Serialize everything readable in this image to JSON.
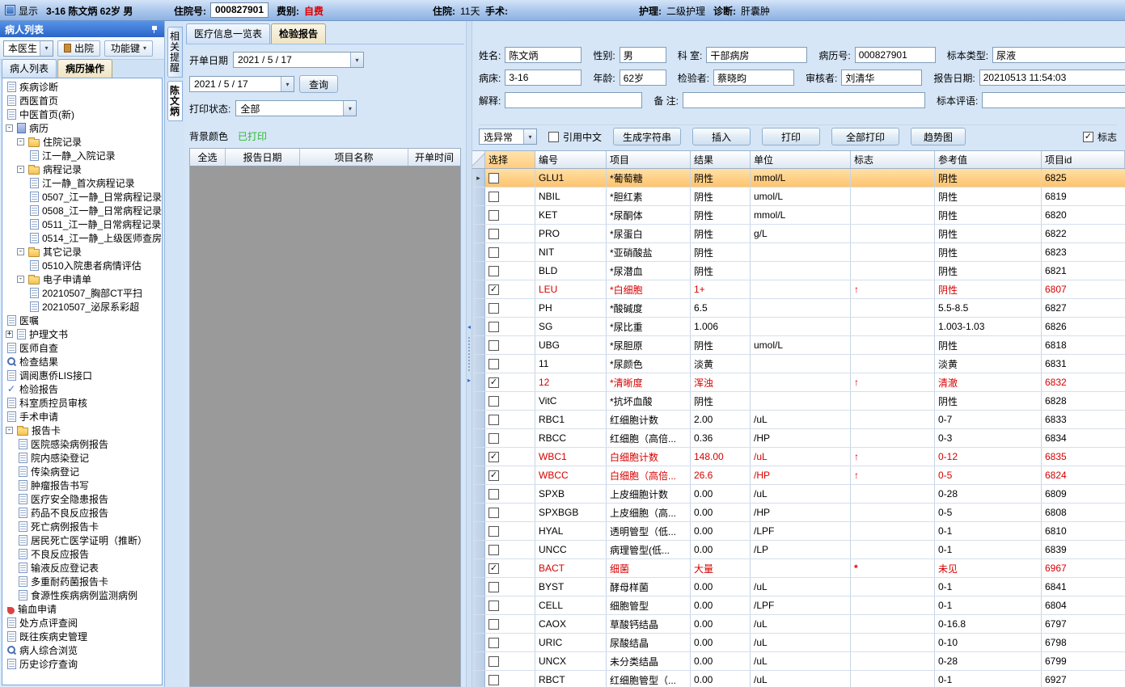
{
  "top_bar": {
    "display": "显示",
    "patient_summary": "3-16   陈文炳 62岁 男",
    "admission_label": "住院号:",
    "admission_no": "000827901",
    "fee_label": "费别:",
    "fee": "自费",
    "stay_label": "住院:",
    "stay": "11天",
    "surgery_label": "手术:",
    "nursing_label": "护理:",
    "nursing": "二级护理",
    "diagnosis_label": "诊断:",
    "diagnosis": "肝囊肿"
  },
  "sidebar": {
    "title": "病人列表",
    "doctor_filter": "本医生",
    "discharge": "出院",
    "function_keys": "功能键",
    "tabs": [
      {
        "label": "病人列表"
      },
      {
        "label": "病历操作"
      }
    ],
    "tree": [
      {
        "level": 0,
        "icon": "doc",
        "label": "疾病诊断"
      },
      {
        "level": 0,
        "icon": "doc",
        "label": "西医首页"
      },
      {
        "level": 0,
        "icon": "doc",
        "label": "中医首页(新)"
      },
      {
        "level": 0,
        "icon": "book",
        "exp": "-",
        "label": "病历"
      },
      {
        "level": 1,
        "icon": "folder",
        "exp": "-",
        "label": "住院记录"
      },
      {
        "level": 2,
        "icon": "doc",
        "label": "江一静_入院记录"
      },
      {
        "level": 1,
        "icon": "folder",
        "exp": "-",
        "label": "病程记录"
      },
      {
        "level": 2,
        "icon": "doc",
        "label": "江一静_首次病程记录"
      },
      {
        "level": 2,
        "icon": "doc",
        "label": "0507_江一静_日常病程记录"
      },
      {
        "level": 2,
        "icon": "doc",
        "label": "0508_江一静_日常病程记录"
      },
      {
        "level": 2,
        "icon": "doc",
        "label": "0511_江一静_日常病程记录"
      },
      {
        "level": 2,
        "icon": "doc",
        "label": "0514_江一静_上级医师查房"
      },
      {
        "level": 1,
        "icon": "folder",
        "exp": "-",
        "label": "其它记录"
      },
      {
        "level": 2,
        "icon": "doc",
        "label": "0510入院患者病情评估"
      },
      {
        "level": 1,
        "icon": "folder",
        "exp": "-",
        "label": "电子申请单"
      },
      {
        "level": 2,
        "icon": "doc",
        "label": "20210507_胸部CT平扫"
      },
      {
        "level": 2,
        "icon": "doc",
        "label": "20210507_泌尿系彩超"
      },
      {
        "level": 0,
        "icon": "doc",
        "label": "医嘱"
      },
      {
        "level": 0,
        "icon": "doc",
        "exp": "+",
        "label": "护理文书"
      },
      {
        "level": 0,
        "icon": "doc",
        "label": "医师自查"
      },
      {
        "level": 0,
        "icon": "search",
        "label": "检查结果"
      },
      {
        "level": 0,
        "icon": "doc",
        "label": "调阅惠侨LIS接口"
      },
      {
        "level": 0,
        "icon": "check",
        "label": "检验报告"
      },
      {
        "level": 0,
        "icon": "doc",
        "label": "科室质控员审核"
      },
      {
        "level": 0,
        "icon": "doc",
        "label": "手术申请"
      },
      {
        "level": 0,
        "icon": "folder",
        "exp": "-",
        "label": "报告卡"
      },
      {
        "level": 1,
        "icon": "doc",
        "label": "医院感染病例报告"
      },
      {
        "level": 1,
        "icon": "doc",
        "label": "院内感染登记"
      },
      {
        "level": 1,
        "icon": "doc",
        "label": "传染病登记"
      },
      {
        "level": 1,
        "icon": "doc",
        "label": "肿瘤报告书写"
      },
      {
        "level": 1,
        "icon": "doc",
        "label": "医疗安全隐患报告"
      },
      {
        "level": 1,
        "icon": "doc",
        "label": "药品不良反应报告"
      },
      {
        "level": 1,
        "icon": "doc",
        "label": "死亡病例报告卡"
      },
      {
        "level": 1,
        "icon": "doc",
        "label": "居民死亡医学证明（推断）"
      },
      {
        "level": 1,
        "icon": "doc",
        "label": "不良反应报告"
      },
      {
        "level": 1,
        "icon": "doc",
        "label": "输液反应登记表"
      },
      {
        "level": 1,
        "icon": "doc",
        "label": "多重耐药菌报告卡"
      },
      {
        "level": 1,
        "icon": "doc",
        "label": "食源性疾病病例监测病例"
      },
      {
        "level": 0,
        "icon": "blood",
        "label": "输血申请"
      },
      {
        "level": 0,
        "icon": "doc",
        "label": "处方点评查阅"
      },
      {
        "level": 0,
        "icon": "doc",
        "label": "既往疾病史管理"
      },
      {
        "level": 0,
        "icon": "search",
        "label": "病人综合浏览"
      },
      {
        "level": 0,
        "icon": "doc",
        "label": "历史诊疗查询"
      }
    ]
  },
  "side_strip": {
    "reminder_tab": "相关提醒",
    "patient_tab": "陈文炳"
  },
  "middle": {
    "tabs": [
      {
        "label": "医疗信息一览表"
      },
      {
        "label": "检验报告"
      }
    ],
    "order_date_label": "开单日期",
    "date_from": "2021 / 5 / 17",
    "date_to": "2021 / 5 / 17",
    "query": "查询",
    "print_status_label": "打印状态:",
    "print_status": "全部",
    "bg_label": "背景颜色",
    "printed": "已打印",
    "headers": [
      "全选",
      "报告日期",
      "项目名称",
      "开单时间"
    ]
  },
  "report": {
    "info": {
      "name_label": "姓名:",
      "name": "陈文炳",
      "sex_label": "性别:",
      "sex": "男",
      "dept_label": "科  室:",
      "dept": "干部病房",
      "chart_label": "病历号:",
      "chart_no": "000827901",
      "specimen_label": "标本类型:",
      "specimen": "尿液",
      "bed_label": "病床:",
      "bed": "3-16",
      "age_label": "年龄:",
      "age": "62岁",
      "tester_label": "检验者:",
      "tester": "蔡晓昀",
      "reviewer_label": "审核者:",
      "reviewer": "刘清华",
      "date_label": "报告日期:",
      "date": "20210513 11:54:03",
      "explain_label": "解释:",
      "note_label": "备  注:",
      "comment_label": "标本评语:"
    },
    "toolbar": {
      "select_abnormal": "选异常",
      "quote_chinese": "引用中文",
      "generate_string": "生成字符串",
      "insert": "插入",
      "print": "打印",
      "print_all": "全部打印",
      "trend_chart": "趋势图",
      "flag": "标志"
    },
    "table": {
      "headers": [
        "选择",
        "编号",
        "项目",
        "结果",
        "单位",
        "标志",
        "参考值",
        "项目id"
      ],
      "rows": [
        {
          "c": false,
          "code": "GLU1",
          "item": "*葡萄糖",
          "res": "阴性",
          "unit": "mmol/L",
          "flag": "",
          "ref": "阴性",
          "id": "6825",
          "ab": false,
          "sel": true
        },
        {
          "c": false,
          "code": "NBIL",
          "item": "*胆红素",
          "res": "阴性",
          "unit": "umol/L",
          "flag": "",
          "ref": "阴性",
          "id": "6819",
          "ab": false,
          "sel": false
        },
        {
          "c": false,
          "code": "KET",
          "item": "*尿酮体",
          "res": "阴性",
          "unit": "mmol/L",
          "flag": "",
          "ref": "阴性",
          "id": "6820",
          "ab": false,
          "sel": false
        },
        {
          "c": false,
          "code": "PRO",
          "item": "*尿蛋白",
          "res": "阴性",
          "unit": "g/L",
          "flag": "",
          "ref": "阴性",
          "id": "6822",
          "ab": false,
          "sel": false
        },
        {
          "c": false,
          "code": "NIT",
          "item": "*亚硝酸盐",
          "res": "阴性",
          "unit": "",
          "flag": "",
          "ref": "阴性",
          "id": "6823",
          "ab": false,
          "sel": false
        },
        {
          "c": false,
          "code": "BLD",
          "item": "*尿潜血",
          "res": "阴性",
          "unit": "",
          "flag": "",
          "ref": "阴性",
          "id": "6821",
          "ab": false,
          "sel": false
        },
        {
          "c": true,
          "code": "LEU",
          "item": "*白细胞",
          "res": "1+",
          "unit": "",
          "flag": "↑",
          "ref": "阴性",
          "id": "6807",
          "ab": true,
          "sel": false
        },
        {
          "c": false,
          "code": "PH",
          "item": "*酸碱度",
          "res": "6.5",
          "unit": "",
          "flag": "",
          "ref": "5.5-8.5",
          "id": "6827",
          "ab": false,
          "sel": false
        },
        {
          "c": false,
          "code": "SG",
          "item": "*尿比重",
          "res": "1.006",
          "unit": "",
          "flag": "",
          "ref": "1.003-1.03",
          "id": "6826",
          "ab": false,
          "sel": false
        },
        {
          "c": false,
          "code": "UBG",
          "item": "*尿胆原",
          "res": "阴性",
          "unit": "umol/L",
          "flag": "",
          "ref": "阴性",
          "id": "6818",
          "ab": false,
          "sel": false
        },
        {
          "c": false,
          "code": "11",
          "item": "*尿颜色",
          "res": "淡黄",
          "unit": "",
          "flag": "",
          "ref": "淡黄",
          "id": "6831",
          "ab": false,
          "sel": false
        },
        {
          "c": true,
          "code": "12",
          "item": "*清晰度",
          "res": "浑浊",
          "unit": "",
          "flag": "↑",
          "ref": "清澈",
          "id": "6832",
          "ab": true,
          "sel": false
        },
        {
          "c": false,
          "code": "VitC",
          "item": "*抗坏血酸",
          "res": "阴性",
          "unit": "",
          "flag": "",
          "ref": "阴性",
          "id": "6828",
          "ab": false,
          "sel": false
        },
        {
          "c": false,
          "code": "RBC1",
          "item": "红细胞计数",
          "res": "2.00",
          "unit": "/uL",
          "flag": "",
          "ref": "0-7",
          "id": "6833",
          "ab": false,
          "sel": false
        },
        {
          "c": false,
          "code": "RBCC",
          "item": "红细胞（高倍...",
          "res": "0.36",
          "unit": "/HP",
          "flag": "",
          "ref": "0-3",
          "id": "6834",
          "ab": false,
          "sel": false
        },
        {
          "c": true,
          "code": "WBC1",
          "item": "白细胞计数",
          "res": "148.00",
          "unit": "/uL",
          "flag": "↑",
          "ref": "0-12",
          "id": "6835",
          "ab": true,
          "sel": false
        },
        {
          "c": true,
          "code": "WBCC",
          "item": "白细胞（高倍...",
          "res": "26.6",
          "unit": "/HP",
          "flag": "↑",
          "ref": "0-5",
          "id": "6824",
          "ab": true,
          "sel": false
        },
        {
          "c": false,
          "code": "SPXB",
          "item": "上皮细胞计数",
          "res": "0.00",
          "unit": "/uL",
          "flag": "",
          "ref": "0-28",
          "id": "6809",
          "ab": false,
          "sel": false
        },
        {
          "c": false,
          "code": "SPXBGB",
          "item": "上皮细胞（高...",
          "res": "0.00",
          "unit": "/HP",
          "flag": "",
          "ref": "0-5",
          "id": "6808",
          "ab": false,
          "sel": false
        },
        {
          "c": false,
          "code": "HYAL",
          "item": "透明管型（低...",
          "res": "0.00",
          "unit": "/LPF",
          "flag": "",
          "ref": "0-1",
          "id": "6810",
          "ab": false,
          "sel": false
        },
        {
          "c": false,
          "code": "UNCC",
          "item": "病理管型(低...",
          "res": "0.00",
          "unit": "/LP",
          "flag": "",
          "ref": "0-1",
          "id": "6839",
          "ab": false,
          "sel": false
        },
        {
          "c": true,
          "code": "BACT",
          "item": "细菌",
          "res": "大量",
          "unit": "",
          "flag": "*",
          "ref": "未见",
          "id": "6967",
          "ab": true,
          "sel": false
        },
        {
          "c": false,
          "code": "BYST",
          "item": "酵母样菌",
          "res": "0.00",
          "unit": "/uL",
          "flag": "",
          "ref": "0-1",
          "id": "6841",
          "ab": false,
          "sel": false
        },
        {
          "c": false,
          "code": "CELL",
          "item": "细胞管型",
          "res": "0.00",
          "unit": "/LPF",
          "flag": "",
          "ref": "0-1",
          "id": "6804",
          "ab": false,
          "sel": false
        },
        {
          "c": false,
          "code": "CAOX",
          "item": "草酸钙结晶",
          "res": "0.00",
          "unit": "/uL",
          "flag": "",
          "ref": "0-16.8",
          "id": "6797",
          "ab": false,
          "sel": false
        },
        {
          "c": false,
          "code": "URIC",
          "item": "尿酸结晶",
          "res": "0.00",
          "unit": "/uL",
          "flag": "",
          "ref": "0-10",
          "id": "6798",
          "ab": false,
          "sel": false
        },
        {
          "c": false,
          "code": "UNCX",
          "item": "未分类结晶",
          "res": "0.00",
          "unit": "/uL",
          "flag": "",
          "ref": "0-28",
          "id": "6799",
          "ab": false,
          "sel": false
        },
        {
          "c": false,
          "code": "RBCT",
          "item": "红细胞管型（...",
          "res": "0.00",
          "unit": "/uL",
          "flag": "",
          "ref": "0-1",
          "id": "6927",
          "ab": false,
          "sel": false
        }
      ]
    }
  }
}
